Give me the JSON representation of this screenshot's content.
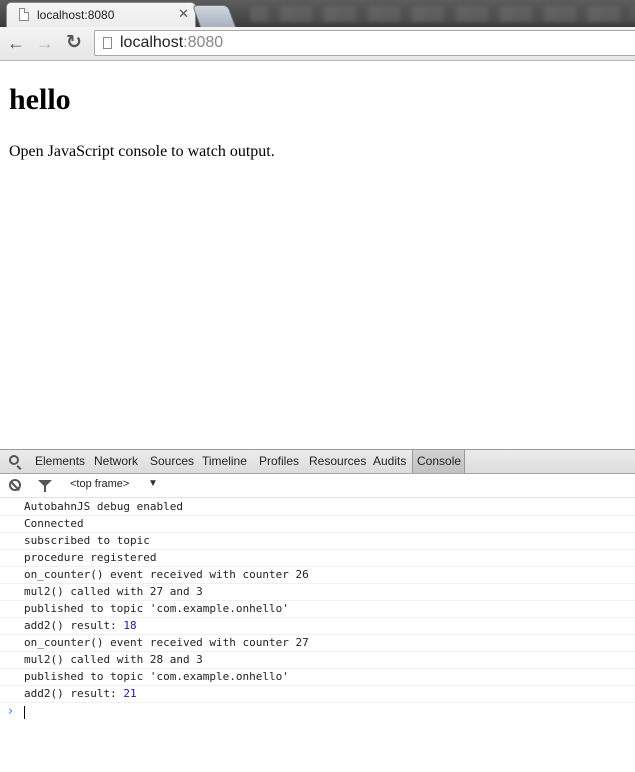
{
  "browser": {
    "active_tab": {
      "title": "localhost:8080",
      "close": "✕"
    },
    "url": {
      "host": "localhost",
      "port": ":8080"
    }
  },
  "icons": {
    "back": "back-arrow-icon",
    "forward": "forward-arrow-icon",
    "reload": "reload-icon"
  },
  "page": {
    "heading": "hello",
    "paragraph": "Open JavaScript console to watch output."
  },
  "devtools": {
    "tabs": [
      "Elements",
      "Network",
      "Sources",
      "Timeline",
      "Profiles",
      "Resources",
      "Audits",
      "Console"
    ],
    "selected_tab": "Console",
    "frame_selector": "<top frame>",
    "frame_caret": "▼",
    "console_lines": [
      {
        "text": "AutobahnJS debug enabled"
      },
      {
        "text": "Connected"
      },
      {
        "text": "subscribed to topic"
      },
      {
        "text": "procedure registered"
      },
      {
        "text": "on_counter() event received with counter 26"
      },
      {
        "text": "mul2() called with 27 and 3"
      },
      {
        "text": "published to topic 'com.example.onhello'"
      },
      {
        "text": "add2() result: ",
        "value": "18"
      },
      {
        "text": "on_counter() event received with counter 27"
      },
      {
        "text": "mul2() called with 28 and 3"
      },
      {
        "text": "published to topic 'com.example.onhello'"
      },
      {
        "text": "add2() result: ",
        "value": "21"
      }
    ],
    "prompt": "›"
  },
  "colors": {
    "console_number": "#1a1aa6",
    "prompt": "#367cf1"
  }
}
